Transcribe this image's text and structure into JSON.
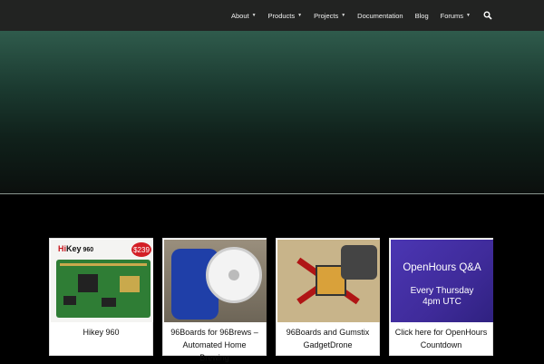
{
  "nav": {
    "items": [
      {
        "label": "About",
        "dropdown": true
      },
      {
        "label": "Products",
        "dropdown": true
      },
      {
        "label": "Projects",
        "dropdown": true
      },
      {
        "label": "Documentation",
        "dropdown": false
      },
      {
        "label": "Blog",
        "dropdown": false
      },
      {
        "label": "Forums",
        "dropdown": true
      }
    ],
    "search_icon": "search-icon",
    "caret": "▼"
  },
  "cards": [
    {
      "title": "Hikey 960",
      "image": {
        "brand_hi": "Hi",
        "brand_key": "Key",
        "version": "960",
        "price": "$239"
      }
    },
    {
      "title_line1": "96Boards for 96Brews –",
      "title_line2": "Automated Home Brewing"
    },
    {
      "title_line1": "96Boards and Gumstix",
      "title_line2": "GadgetDrone"
    },
    {
      "title_line1": "Click here for OpenHours",
      "title_line2": "Countdown",
      "image": {
        "heading": "OpenHours Q&A",
        "line1": "Every Thursday",
        "line2": "4pm UTC"
      }
    }
  ],
  "colors": {
    "topbar": "#222322",
    "hero_top": "#2f5b4c",
    "hero_bottom": "#0b0f0d",
    "openhours_bg": "#4b36b3",
    "price_badge": "#d31f26"
  }
}
